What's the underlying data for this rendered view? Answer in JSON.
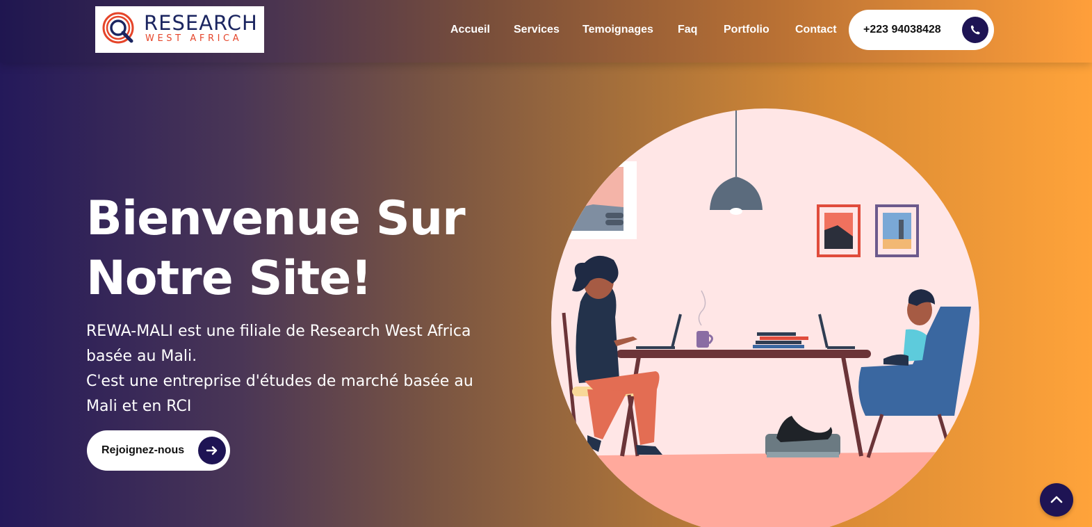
{
  "brand": {
    "name": "RESEARCH",
    "tagline": "WEST AFRICA",
    "colors": {
      "navy": "#1b2560",
      "orange": "#e5452a"
    }
  },
  "nav": {
    "items": [
      {
        "label": "Accueil"
      },
      {
        "label": "Services"
      },
      {
        "label": "Temoignages"
      },
      {
        "label": "Faq"
      },
      {
        "label": "Portfolio"
      },
      {
        "label": "Contact"
      }
    ]
  },
  "contact": {
    "phone": "+223 94038428",
    "icon": "phone-icon"
  },
  "hero": {
    "title_line1": "Bienvenue Sur",
    "title_line2": "Notre Site!",
    "paragraph_line1": "REWA-MALI est une filiale de Research West Africa",
    "paragraph_line2": "basée au Mali.",
    "paragraph_line3": "C'est une entreprise d'études de marché basée au",
    "paragraph_line4": "Mali et en RCI",
    "cta_label": "Rejoignez-nous",
    "cta_icon": "arrow-right-icon"
  },
  "scroll_top": {
    "icon": "chevron-up-icon"
  },
  "theme": {
    "accent_dark": "#1e1454",
    "gradient_start": "#24195a",
    "gradient_end": "#ffa33a"
  }
}
